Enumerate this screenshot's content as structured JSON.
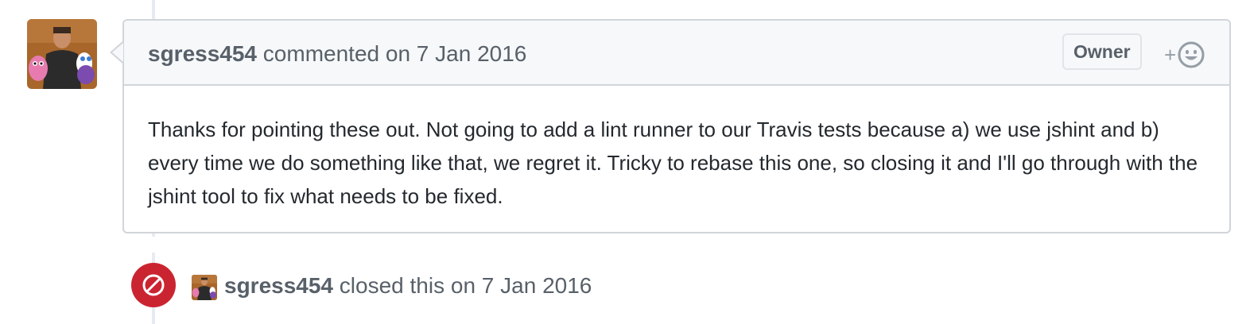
{
  "timeline": {
    "comment": {
      "author": "sgress454",
      "action": "commented on",
      "date": "7 Jan 2016",
      "badge": "Owner",
      "reaction_plus": "+",
      "body": "Thanks for pointing these out. Not going to add a lint runner to our Travis tests because a) we use jshint and b) every time we do something like that, we regret it. Tricky to rebase this one, so closing it and I'll go through with the jshint tool to fix what needs to be fixed."
    },
    "closed_event": {
      "author": "sgress454",
      "action": "closed this on",
      "date": "7 Jan 2016",
      "icon": "circle-slash-icon"
    }
  },
  "colors": {
    "closed_red": "#cb2431",
    "border": "#d1d5da",
    "header_bg": "#f6f8fa",
    "muted_text": "#586069",
    "body_text": "#24292e"
  }
}
